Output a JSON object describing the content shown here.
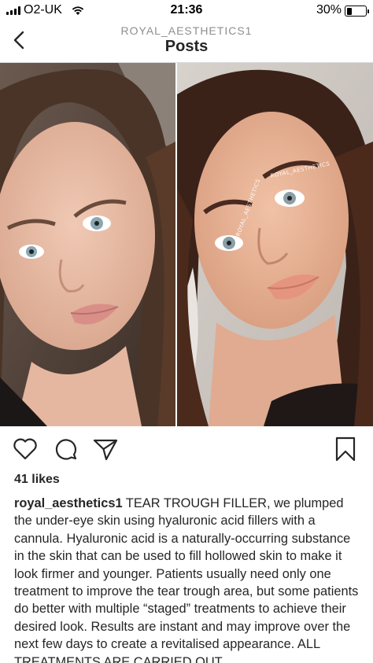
{
  "status_bar": {
    "carrier": "O2-UK",
    "time": "21:36",
    "battery_percent": "30%",
    "battery_level": 0.3
  },
  "nav": {
    "account": "ROYAL_AESTHETICS1",
    "title": "Posts"
  },
  "post": {
    "watermark": "ROYAL_AESTHETICS",
    "likes": "41 likes",
    "caption_user": "royal_aesthetics1",
    "caption_text": "TEAR TROUGH FILLER, we plumped the under-eye skin using hyaluronic acid fillers with a cannula. Hyaluronic acid is a naturally-occurring substance in the skin that can be used to fill hollowed skin to make it look firmer and younger. Patients usually need only one treatment to improve the tear trough area, but some patients do better with multiple “staged” treatments to achieve their desired look. Results are instant and may improve over the next few days to create a revitalised appearance. ALL TREATMENTS ARE CARRIED OUT"
  },
  "icons": {
    "back": "chevron-left-icon",
    "like": "heart-outline-icon",
    "comment": "comment-bubble-icon",
    "share": "paper-plane-icon",
    "save": "bookmark-icon"
  }
}
